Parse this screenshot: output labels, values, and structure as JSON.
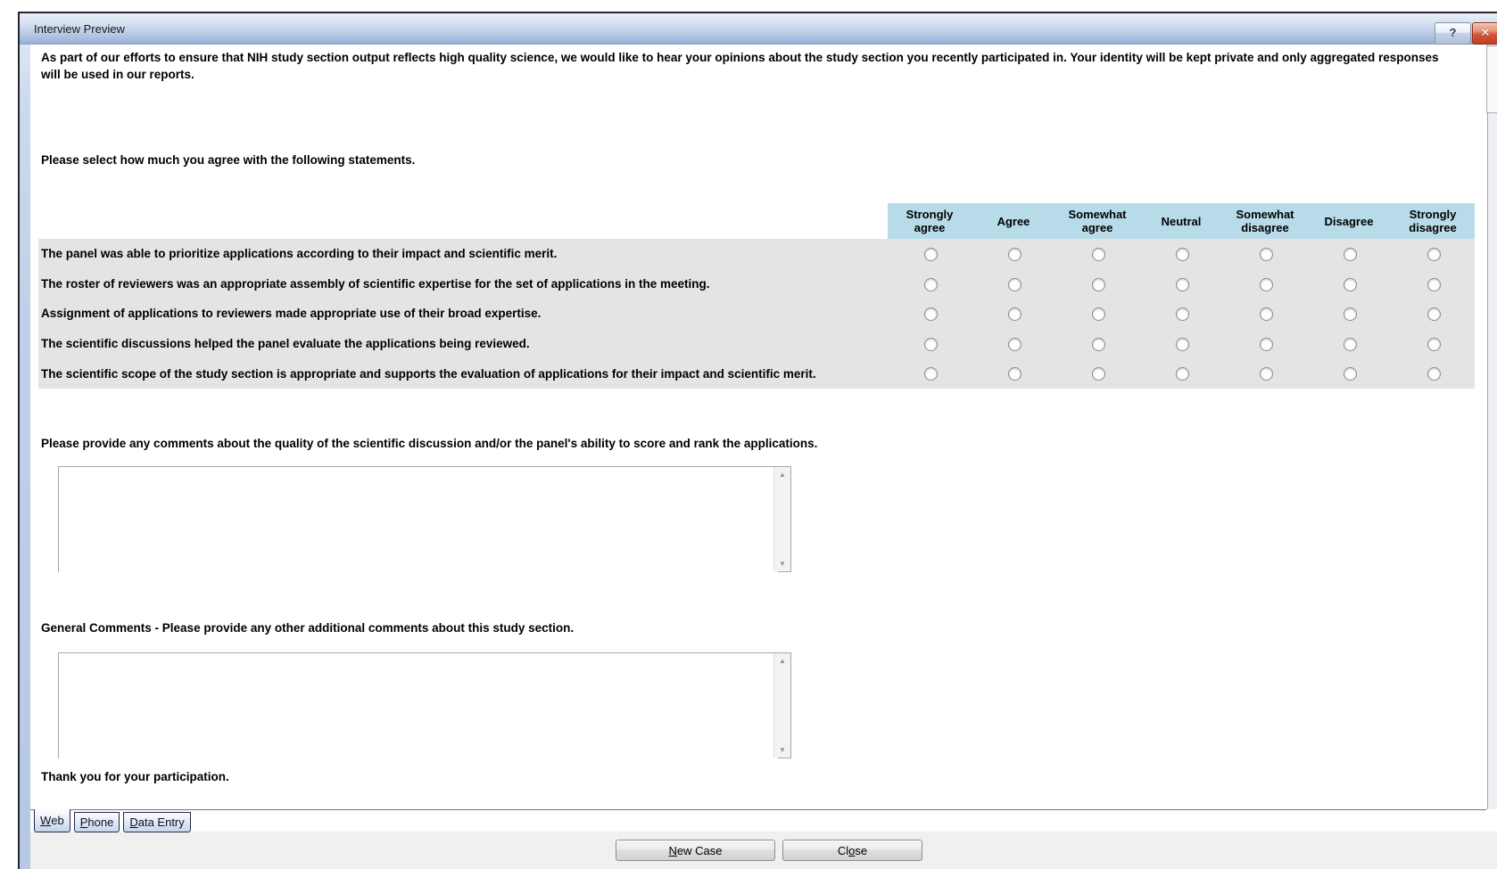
{
  "window": {
    "title": "Interview Preview",
    "help_glyph": "?",
    "close_glyph": "✕"
  },
  "survey": {
    "intro": "As part of our efforts to ensure that NIH study section output reflects high quality science, we would like to hear your opinions about the study section you recently participated in. Your identity will be kept private and only aggregated responses will be used in our reports.",
    "prompt": "Please select how much you agree with the following statements.",
    "matrix": {
      "columns": [
        "Strongly\nagree",
        "Agree",
        "Somewhat\nagree",
        "Neutral",
        "Somewhat\ndisagree",
        "Disagree",
        "Strongly\ndisagree"
      ],
      "rows": [
        "The panel was able to prioritize applications according to their impact and scientific merit.",
        "The roster of reviewers was an appropriate assembly of scientific expertise for the set of applications in the meeting.",
        "Assignment of applications to reviewers made appropriate use of their broad expertise.",
        "The scientific discussions helped the panel evaluate the applications being reviewed.",
        "The scientific scope of the study section is appropriate and supports the evaluation of applications for their impact and scientific merit."
      ]
    },
    "discussion_comments_label": "Please provide any comments about the quality of the scientific discussion and/or the panel's ability to score and rank the applications.",
    "discussion_comments_value": "",
    "general_comments_label": "General Comments - Please provide any other additional comments about this study section.",
    "general_comments_value": "",
    "thanks": "Thank you for your participation."
  },
  "tabs": [
    {
      "label": "Web",
      "accel_index": 0,
      "selected": true
    },
    {
      "label": "Phone",
      "accel_index": 0,
      "selected": false
    },
    {
      "label": "Data Entry",
      "accel_index": 0,
      "selected": false
    }
  ],
  "footer": {
    "buttons": [
      {
        "label": "New Case",
        "accel_index": 0
      },
      {
        "label": "Close",
        "accel_index": 2
      }
    ]
  },
  "colors": {
    "header_blue": "#b8dbe9",
    "row_gray": "#e4e4e4",
    "titlebar_top": "#e9eff8",
    "titlebar_bottom": "#96afd3",
    "close_red": "#c9442a"
  }
}
